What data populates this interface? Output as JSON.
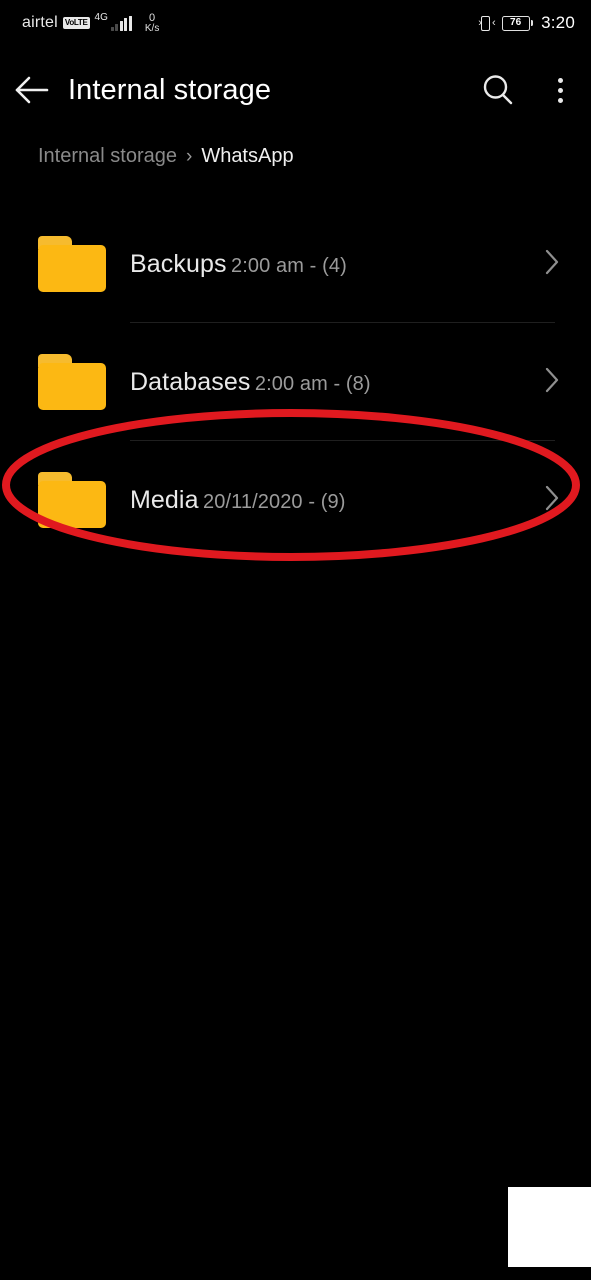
{
  "status_bar": {
    "carrier": "airtel",
    "volte_badge": "VoLTE",
    "network_gen": "4G",
    "signal_icon": "signal-bars-icon",
    "network_speed_value": "0",
    "network_speed_unit": "K/s",
    "vibrate_icon": "vibrate-icon",
    "battery_percent": "76",
    "clock": "3:20"
  },
  "app_bar": {
    "back_icon": "arrow-left-icon",
    "title": "Internal storage",
    "search_icon": "search-icon",
    "menu_icon": "overflow-menu-icon"
  },
  "breadcrumb": {
    "root": "Internal storage",
    "separator": "›",
    "current": "WhatsApp"
  },
  "file_list": {
    "rows": [
      {
        "name": "Backups",
        "meta": "2:00 am - (4)",
        "icon": "folder-icon",
        "chevron": "chevron-right-icon",
        "highlighted": false
      },
      {
        "name": "Databases",
        "meta": "2:00 am - (8)",
        "icon": "folder-icon",
        "chevron": "chevron-right-icon",
        "highlighted": false
      },
      {
        "name": "Media",
        "meta": "20/11/2020 - (9)",
        "icon": "folder-icon",
        "chevron": "chevron-right-icon",
        "highlighted": true
      }
    ]
  },
  "annotation": {
    "shape": "ellipse",
    "target": "Media",
    "color": "#e0191f",
    "stroke_width": 8
  },
  "colors": {
    "background": "#000000",
    "folder": "#fcb813",
    "folder_tab": "#f6bb2e",
    "primary_text": "#e9e9e9",
    "secondary_text": "#9b9b9b",
    "breadcrumb_inactive": "#8a8a8a",
    "divider": "#1f1f1f",
    "annotation_red": "#e0191f",
    "patch_white": "#ffffff"
  }
}
